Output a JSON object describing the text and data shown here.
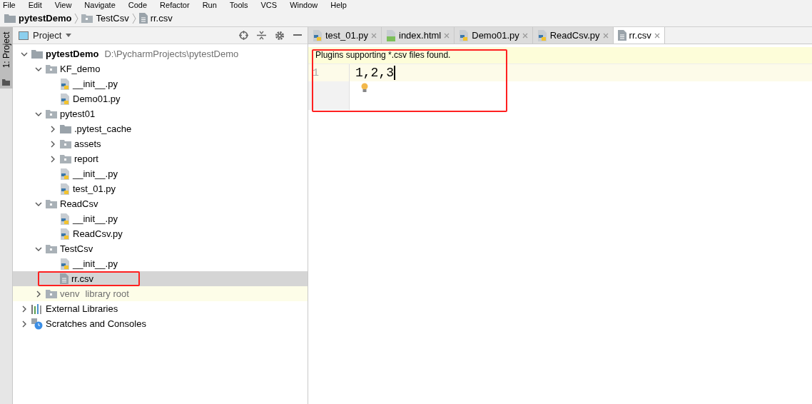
{
  "menu_bar": [
    "File",
    "Edit",
    "View",
    "Navigate",
    "Code",
    "Refactor",
    "Run",
    "Tools",
    "VCS",
    "Window",
    "Help"
  ],
  "breadcrumbs": [
    {
      "label": "pytestDemo",
      "kind": "root"
    },
    {
      "label": "TestCsv",
      "kind": "package"
    },
    {
      "label": "rr.csv",
      "kind": "text"
    }
  ],
  "side_stripe": {
    "label": "1: Project"
  },
  "project_panel": {
    "title": "Project",
    "tree": [
      {
        "label": "pytestDemo",
        "path": "D:\\PycharmProjects\\pytestDemo",
        "kind": "root",
        "expanded": true,
        "selected": false,
        "children": [
          {
            "label": "KF_demo",
            "kind": "package",
            "expanded": true,
            "selected": false,
            "children": [
              {
                "label": "__init__.py",
                "kind": "python",
                "selected": false
              },
              {
                "label": "Demo01.py",
                "kind": "python",
                "selected": false
              }
            ]
          },
          {
            "label": "pytest01",
            "kind": "package",
            "expanded": true,
            "selected": false,
            "children": [
              {
                "label": ".pytest_cache",
                "kind": "folder",
                "expanded": false,
                "selected": false
              },
              {
                "label": "assets",
                "kind": "package",
                "expanded": false,
                "selected": false
              },
              {
                "label": "report",
                "kind": "package",
                "expanded": false,
                "selected": false
              },
              {
                "label": "__init__.py",
                "kind": "python",
                "selected": false
              },
              {
                "label": "test_01.py",
                "kind": "python",
                "selected": false
              }
            ]
          },
          {
            "label": "ReadCsv",
            "kind": "package",
            "expanded": true,
            "selected": false,
            "children": [
              {
                "label": "__init__.py",
                "kind": "python",
                "selected": false
              },
              {
                "label": "ReadCsv.py",
                "kind": "python",
                "selected": false
              }
            ]
          },
          {
            "label": "TestCsv",
            "kind": "package",
            "expanded": true,
            "selected": false,
            "children": [
              {
                "label": "__init__.py",
                "kind": "python",
                "selected": false
              },
              {
                "label": "rr.csv",
                "kind": "text",
                "selected": true
              }
            ]
          },
          {
            "label": "venv",
            "path": "library root",
            "kind": "library",
            "expanded": false,
            "selected": false
          }
        ]
      },
      {
        "label": "External Libraries",
        "kind": "libraries",
        "expanded": false,
        "selected": false
      },
      {
        "label": "Scratches and Consoles",
        "kind": "scratches",
        "expanded": false,
        "selected": false
      }
    ]
  },
  "editor": {
    "tabs": [
      {
        "label": "test_01.py",
        "kind": "python",
        "selected": false
      },
      {
        "label": "index.html",
        "kind": "html",
        "selected": false
      },
      {
        "label": "Demo01.py",
        "kind": "python",
        "selected": false
      },
      {
        "label": "ReadCsv.py",
        "kind": "python",
        "selected": false
      },
      {
        "label": "rr.csv",
        "kind": "text",
        "selected": true
      }
    ],
    "banner": "Plugins supporting *.csv files found.",
    "lines": [
      {
        "number": "1",
        "text": "1,2,3"
      }
    ]
  }
}
